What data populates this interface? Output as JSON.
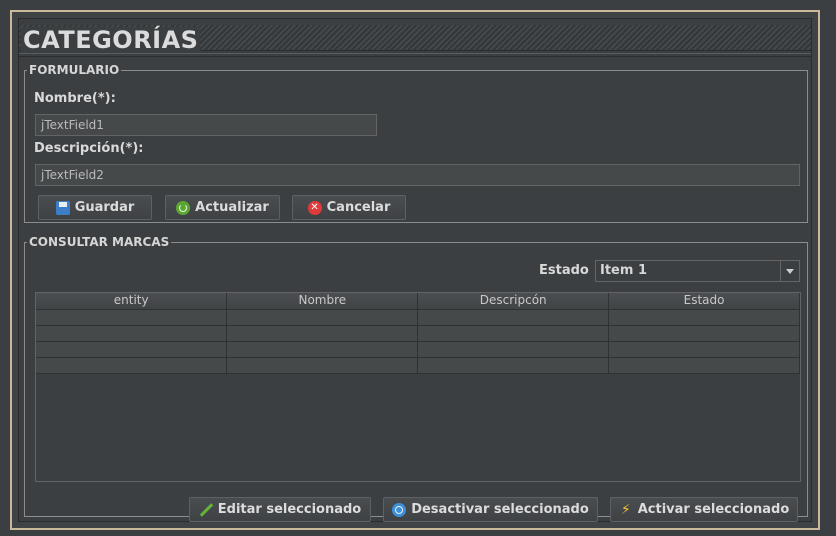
{
  "window": {
    "title": "CATEGORÍAS"
  },
  "form": {
    "legend": "FORMULARIO",
    "name_label": "Nombre(*):",
    "name_value": "jTextField1",
    "description_label": "Descripción(*):",
    "description_value": "jTextField2",
    "buttons": {
      "save": "Guardar",
      "update": "Actualizar",
      "cancel": "Cancelar"
    }
  },
  "query": {
    "legend": "CONSULTAR MARCAS",
    "estado_label": "Estado",
    "estado_selected": "Item 1",
    "table": {
      "columns": [
        "entity",
        "Nombre",
        "Descripcón",
        "Estado"
      ],
      "rows": [
        [
          "",
          "",
          "",
          ""
        ],
        [
          "",
          "",
          "",
          ""
        ],
        [
          "",
          "",
          "",
          ""
        ],
        [
          "",
          "",
          "",
          ""
        ]
      ]
    },
    "actions": {
      "edit": "Editar seleccionado",
      "deactivate": "Desactivar seleccionado",
      "activate": "Activar seleccionado"
    }
  },
  "icons": {
    "save": "floppy-disk-icon",
    "update": "refresh-icon",
    "cancel": "close-circle-icon",
    "edit": "pencil-icon",
    "deactivate": "power-icon",
    "activate": "lightning-icon"
  },
  "colors": {
    "background": "#3c3f41",
    "frame_border": "#c9b89a",
    "text": "#d6d6d6"
  }
}
